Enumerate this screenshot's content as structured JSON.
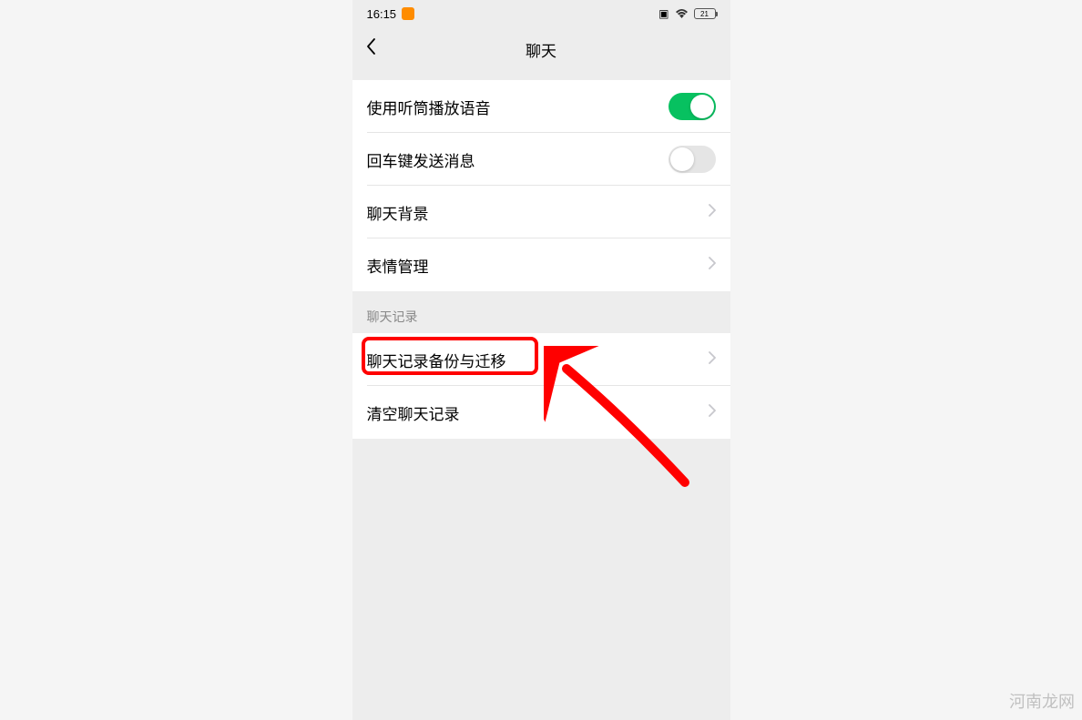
{
  "status_bar": {
    "time": "16:15",
    "battery_level": "21"
  },
  "header": {
    "title": "聊天"
  },
  "group1": {
    "row1": {
      "label": "使用听筒播放语音",
      "toggle": true
    },
    "row2": {
      "label": "回车键发送消息",
      "toggle": false
    },
    "row3": {
      "label": "聊天背景"
    },
    "row4": {
      "label": "表情管理"
    }
  },
  "section2": {
    "header": "聊天记录",
    "row1": {
      "label": "聊天记录备份与迁移"
    },
    "row2": {
      "label": "清空聊天记录"
    }
  },
  "watermark": "河南龙网"
}
